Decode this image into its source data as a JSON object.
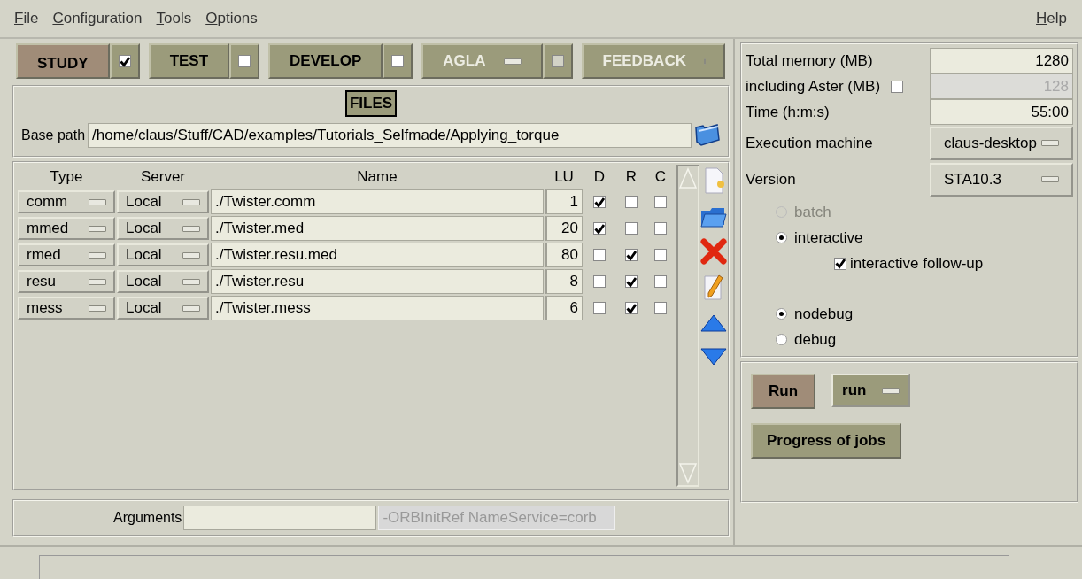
{
  "menu": {
    "left": [
      "File",
      "Configuration",
      "Tools",
      "Options"
    ],
    "right": [
      "Help"
    ]
  },
  "modes": [
    {
      "label": "STUDY",
      "kind": "check",
      "selected": true,
      "checked": true,
      "disabled": false
    },
    {
      "label": "TEST",
      "kind": "check",
      "selected": false,
      "checked": false,
      "disabled": false
    },
    {
      "label": "DEVELOP",
      "kind": "check",
      "selected": false,
      "checked": false,
      "disabled": false
    },
    {
      "label": "AGLA",
      "kind": "menucheck",
      "selected": false,
      "checked": false,
      "disabled": true
    },
    {
      "label": "FEEDBACK",
      "kind": "menu",
      "selected": false,
      "disabled": true
    }
  ],
  "files": {
    "title": "FILES",
    "base_path_label": "Base path",
    "base_path": "/home/claus/Stuff/CAD/examples/Tutorials_Selfmade/Applying_torque",
    "columns": [
      "Type",
      "Server",
      "Name",
      "LU",
      "D",
      "R",
      "C"
    ],
    "rows": [
      {
        "type": "comm",
        "server": "Local",
        "name": "./Twister.comm",
        "lu": "1",
        "d": true,
        "r": false,
        "c": false
      },
      {
        "type": "mmed",
        "server": "Local",
        "name": "./Twister.med",
        "lu": "20",
        "d": true,
        "r": false,
        "c": false
      },
      {
        "type": "rmed",
        "server": "Local",
        "name": "./Twister.resu.med",
        "lu": "80",
        "d": false,
        "r": true,
        "c": false
      },
      {
        "type": "resu",
        "server": "Local",
        "name": "./Twister.resu",
        "lu": "8",
        "d": false,
        "r": true,
        "c": false
      },
      {
        "type": "mess",
        "server": "Local",
        "name": "./Twister.mess",
        "lu": "6",
        "d": false,
        "r": true,
        "c": false
      }
    ]
  },
  "arguments": {
    "label": "Arguments",
    "extra": "-ORBInitRef NameService=corb"
  },
  "settings": [
    {
      "kind": "field",
      "label": "Total memory (MB)",
      "value": "1280",
      "disabled": false
    },
    {
      "kind": "checkfield",
      "label": "including Aster (MB)",
      "checked": false,
      "value": "128",
      "disabled": true
    },
    {
      "kind": "field",
      "label": "Time (h:m:s)",
      "value": "55:00",
      "disabled": false
    },
    {
      "kind": "menu",
      "label": "Execution machine",
      "value": "claus-desktop"
    },
    {
      "kind": "menu",
      "label": "Version",
      "value": "STA10.3"
    }
  ],
  "run_options": [
    {
      "kind": "radio",
      "label": "batch",
      "selected": false,
      "disabled": true
    },
    {
      "kind": "radio",
      "label": "interactive",
      "selected": true,
      "disabled": false
    },
    {
      "kind": "check",
      "label": "interactive follow-up",
      "checked": true,
      "disabled": false
    },
    {
      "kind": "gap"
    },
    {
      "kind": "radio",
      "label": "nodebug",
      "selected": true,
      "disabled": false
    },
    {
      "kind": "radio",
      "label": "debug",
      "selected": false,
      "disabled": false
    }
  ],
  "actions": {
    "run_button": "Run",
    "run_menu": "run",
    "progress_button": "Progress of jobs"
  }
}
